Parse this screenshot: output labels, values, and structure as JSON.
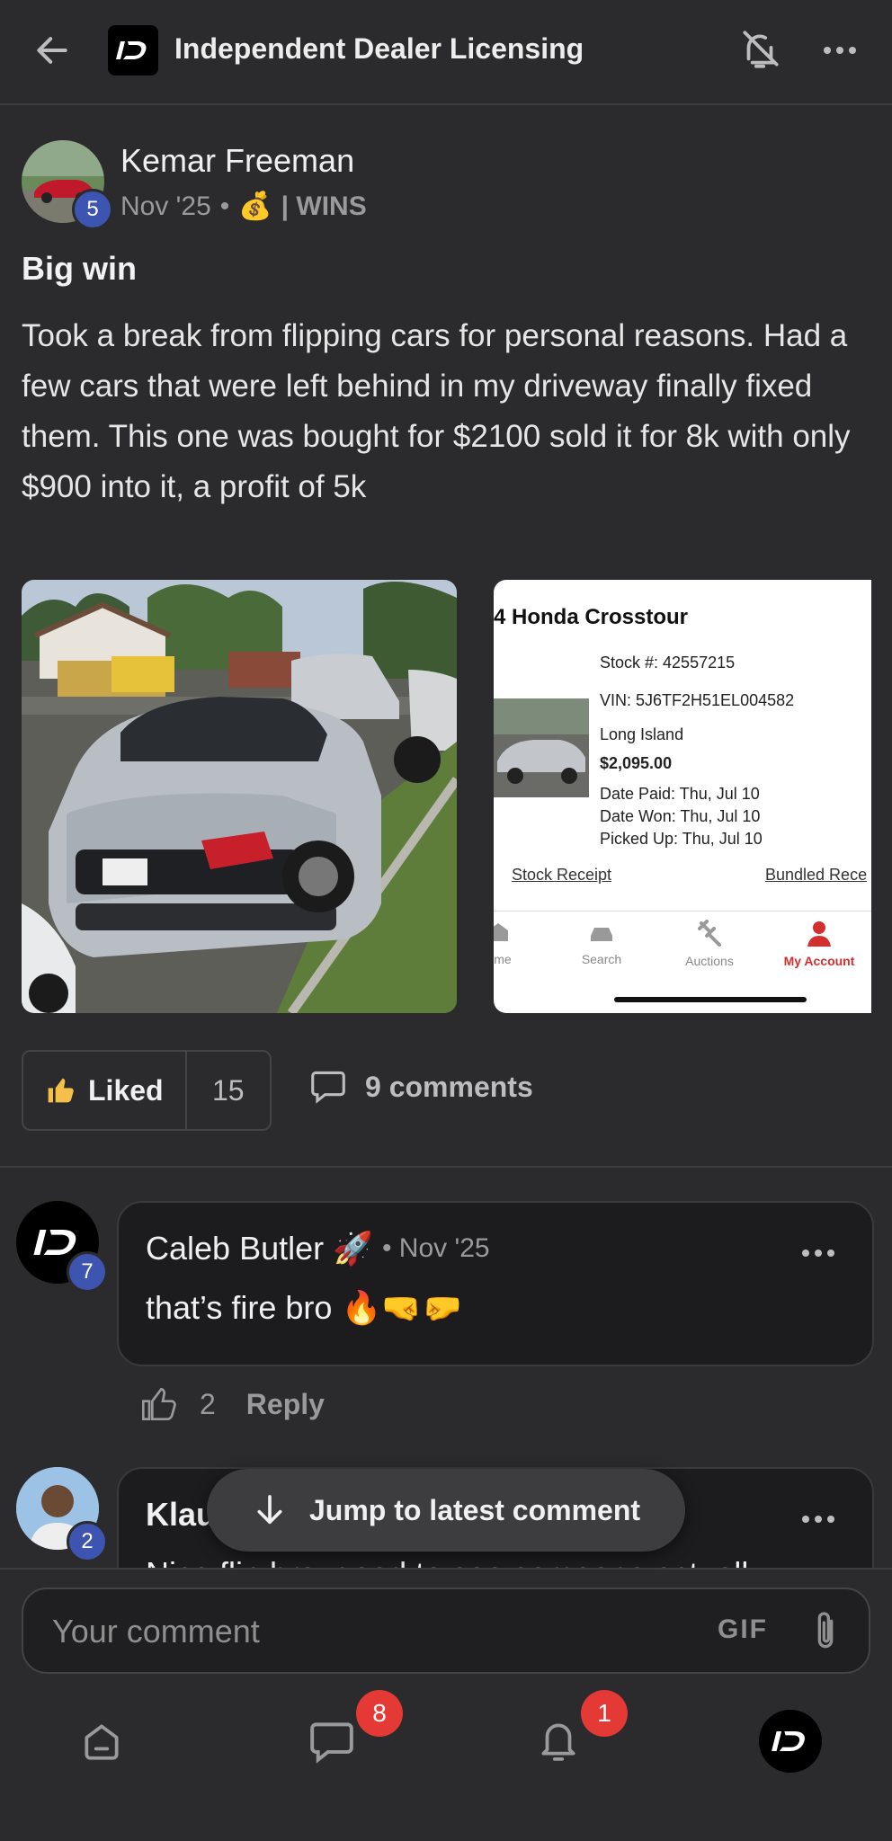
{
  "header": {
    "title": "Independent Dealer Licensing"
  },
  "post": {
    "author": "Kemar Freeman",
    "level": "5",
    "date": "Nov '25",
    "separator": "•",
    "category_emoji": "💰",
    "category": "| WINS",
    "title": "Big win",
    "body": "Took a break from flipping cars for personal reasons. Had a few cars that were left behind in my driveway finally fixed them. This one was bought for $2100 sold it for 8k with only $900 into it, a profit of 5k",
    "like_label": "Liked",
    "like_count": "15",
    "comments_label": "9 comments"
  },
  "receipt": {
    "title": "4 Honda Crosstour",
    "stock": "Stock #:   42557215",
    "vin": "VIN:   5J6TF2H51EL004582",
    "location": "Long Island",
    "price": "$2,095.00",
    "date_paid": "Date Paid: Thu, Jul 10",
    "date_won": "Date Won: Thu, Jul 10",
    "picked_up": "Picked Up: Thu, Jul 10",
    "link1": "Stock Receipt",
    "link2": "Bundled Rece",
    "nav": [
      "me",
      "Search",
      "Auctions",
      "My Account"
    ]
  },
  "comments": [
    {
      "author": "Caleb Butler",
      "emoji": "🚀",
      "date": "• Nov '25",
      "text": "that’s fire bro 🔥🤜🤛",
      "level": "7",
      "likes": "2",
      "reply": "Reply"
    },
    {
      "author": "Klau",
      "level": "2",
      "text": "Nice flip bro, good to see someone actually"
    }
  ],
  "jump_label": "Jump to latest comment",
  "composer": {
    "placeholder": "Your comment",
    "gif_label": "GIF"
  },
  "tabbar": {
    "chat_badge": "8",
    "notif_badge": "1"
  },
  "colors": {
    "background": "#2b2b2d",
    "accent_level": "#3d55b0",
    "badge": "#e53935",
    "like_icon": "#f5c04a",
    "account_red": "#d32f2f"
  }
}
